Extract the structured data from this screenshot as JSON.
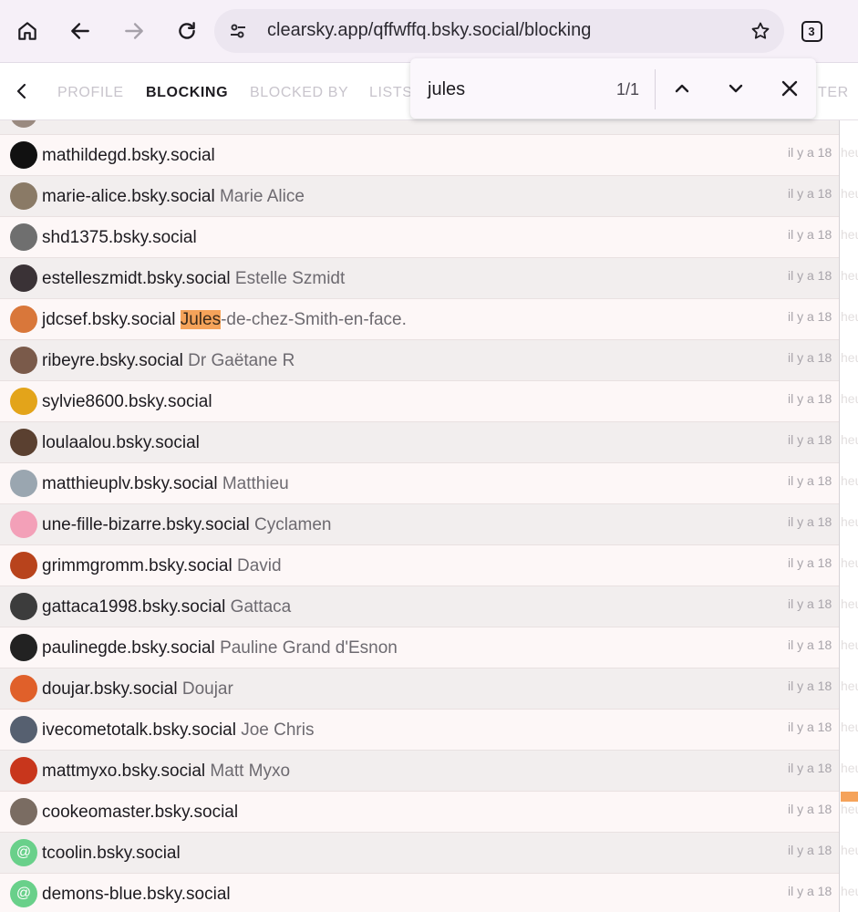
{
  "browser": {
    "url": "clearsky.app/qffwffq.bsky.social/blocking",
    "tab_count": "3",
    "icons": [
      "home-icon",
      "back-icon",
      "forward-icon",
      "reload-icon",
      "tune-icon",
      "star-icon",
      "tab-switcher-icon"
    ]
  },
  "nav_tabs": {
    "profile": "PROFILE",
    "blocking": "BLOCKING",
    "blocked_by": "BLOCKED BY",
    "lists": "LISTS",
    "partial_tail": "TER"
  },
  "find": {
    "query": "jules",
    "count": "1/1"
  },
  "rows": [
    {
      "handle": "mathildegd.bsky.social",
      "display_name": "",
      "time": "il y a 18",
      "time_tail": "heu",
      "avatar_color": "#111111"
    },
    {
      "handle": "marie-alice.bsky.social",
      "display_name": "Marie Alice",
      "time": "il y a 18",
      "time_tail": "heu",
      "avatar_color": "#8a7a66"
    },
    {
      "handle": "shd1375.bsky.social",
      "display_name": "",
      "time": "il y a 18",
      "time_tail": "heu",
      "avatar_color": "#6f6f6f"
    },
    {
      "handle": "estelleszmidt.bsky.social",
      "display_name": "Estelle Szmidt",
      "time": "il y a 18",
      "time_tail": "heu",
      "avatar_color": "#3a3236"
    },
    {
      "handle": "jdcsef.bsky.social",
      "display_name_match": "Jules",
      "display_name_rest": "-de-chez-Smith-en-face.",
      "time": "il y a 18",
      "time_tail": "heu",
      "avatar_color": "#d9773a"
    },
    {
      "handle": "ribeyre.bsky.social",
      "display_name": "Dr Gaëtane R",
      "time": "il y a 18",
      "time_tail": "heu",
      "avatar_color": "#7a5a4a"
    },
    {
      "handle": "sylvie8600.bsky.social",
      "display_name": "",
      "time": "il y a 18",
      "time_tail": "heu",
      "avatar_color": "#e3a41a"
    },
    {
      "handle": "loulaalou.bsky.social",
      "display_name": "",
      "time": "il y a 18",
      "time_tail": "heu",
      "avatar_color": "#5a4030"
    },
    {
      "handle": "matthieuplv.bsky.social",
      "display_name": "Matthieu",
      "time": "il y a 18",
      "time_tail": "heu",
      "avatar_color": "#9aa6b0"
    },
    {
      "handle": "une-fille-bizarre.bsky.social",
      "display_name": "Cyclamen",
      "time": "il y a 18",
      "time_tail": "heu",
      "avatar_color": "#f3a0b8"
    },
    {
      "handle": "grimmgromm.bsky.social",
      "display_name": "David",
      "time": "il y a 18",
      "time_tail": "heu",
      "avatar_color": "#b8431c"
    },
    {
      "handle": "gattaca1998.bsky.social",
      "display_name": "Gattaca",
      "time": "il y a 18",
      "time_tail": "heu",
      "avatar_color": "#3c3c3c"
    },
    {
      "handle": "paulinegde.bsky.social",
      "display_name": "Pauline Grand d'Esnon",
      "time": "il y a 18",
      "time_tail": "heu",
      "avatar_color": "#222222"
    },
    {
      "handle": "doujar.bsky.social",
      "display_name": "Doujar",
      "time": "il y a 18",
      "time_tail": "heu",
      "avatar_color": "#e0602a"
    },
    {
      "handle": "ivecometotalk.bsky.social",
      "display_name": "Joe Chris",
      "time": "il y a 18",
      "time_tail": "heu",
      "avatar_color": "#566070"
    },
    {
      "handle": "mattmyxo.bsky.social",
      "display_name": "Matt Myxo",
      "time": "il y a 18",
      "time_tail": "heu",
      "avatar_color": "#c8361c"
    },
    {
      "handle": "cookeomaster.bsky.social",
      "display_name": "",
      "time": "il y a 18",
      "time_tail": "heu",
      "avatar_color": "#7a6c62"
    },
    {
      "handle": "tcoolin.bsky.social",
      "display_name": "",
      "time": "il y a 18",
      "time_tail": "heu",
      "avatar_color": "#69d08a",
      "avatar_glyph": "@"
    },
    {
      "handle": "demons-blue.bsky.social",
      "display_name": "",
      "time": "il y a 18",
      "time_tail": "heu",
      "avatar_color": "#69d08a",
      "avatar_glyph": "@"
    }
  ],
  "colors": {
    "find_highlight": "#f5a35a",
    "toolbar_bg": "#f6f0f8"
  }
}
